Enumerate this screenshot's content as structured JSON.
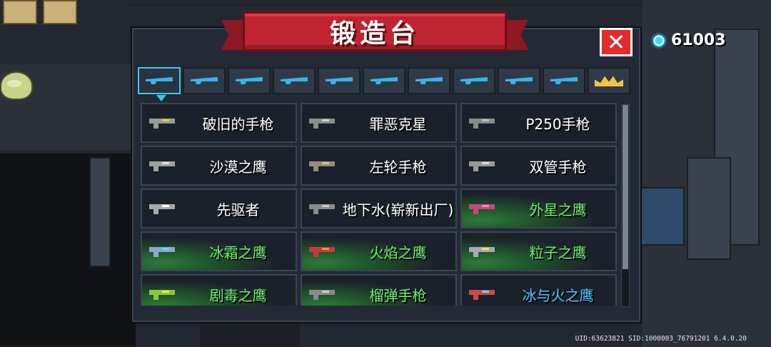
{
  "title": "锻造台",
  "gems": {
    "icon": "blue-gem-icon",
    "count": "61003"
  },
  "close": {
    "label": "✕"
  },
  "tabs": [
    {
      "name": "pistol-tab",
      "active": true
    },
    {
      "name": "rifle-tab"
    },
    {
      "name": "shotgun-tab"
    },
    {
      "name": "sniper-tab"
    },
    {
      "name": "launcher-tab"
    },
    {
      "name": "bow-tab"
    },
    {
      "name": "staff-tab"
    },
    {
      "name": "spear-tab"
    },
    {
      "name": "shuriken-tab"
    },
    {
      "name": "fish-tab"
    },
    {
      "name": "crown-tab"
    }
  ],
  "weapons": [
    {
      "name": "破旧的手枪",
      "color": "#9a9a9a",
      "shine": "#e6c93a",
      "style": "white"
    },
    {
      "name": "罪恶克星",
      "color": "#8c8c8c",
      "shine": "#cfcfcf",
      "style": "white"
    },
    {
      "name": "P250手枪",
      "color": "#8a8a8a",
      "shine": "#bdbdbd",
      "style": "white"
    },
    {
      "name": "沙漠之鹰",
      "color": "#a0a0a0",
      "shine": "#e0e0e0",
      "style": "white"
    },
    {
      "name": "左轮手枪",
      "color": "#9a8a7a",
      "shine": "#d4c09a",
      "style": "white"
    },
    {
      "name": "双管手枪",
      "color": "#9a9a9a",
      "shine": "#dcdcdc",
      "style": "white"
    },
    {
      "name": "先驱者",
      "color": "#a8a8a8",
      "shine": "#ffffff",
      "style": "white"
    },
    {
      "name": "地下水(崭新出厂)",
      "color": "#8a8a8a",
      "shine": "#c8c8c8",
      "style": "white"
    },
    {
      "name": "外星之鹰",
      "color": "#c04a7a",
      "shine": "#f08ab0",
      "style": "green"
    },
    {
      "name": "冰霜之鹰",
      "color": "#8aa8c8",
      "shine": "#6ad4ff",
      "style": "green"
    },
    {
      "name": "火焰之鹰",
      "color": "#c83a3a",
      "shine": "#ff8a4a",
      "style": "green"
    },
    {
      "name": "粒子之鹰",
      "color": "#a8a8b8",
      "shine": "#ffe04a",
      "style": "green"
    },
    {
      "name": "剧毒之鹰",
      "color": "#8ac83a",
      "shine": "#d4f04a",
      "style": "green"
    },
    {
      "name": "榴弹手枪",
      "color": "#8a8a8a",
      "shine": "#c8c8c8",
      "style": "green"
    },
    {
      "name": "冰与火之鹰",
      "color": "#c84a4a",
      "shine": "#6ad4ff",
      "style": "blue"
    }
  ],
  "footer": {
    "uid": "UID:63623821 SID:1000003_76791201 6.4.0.20"
  }
}
